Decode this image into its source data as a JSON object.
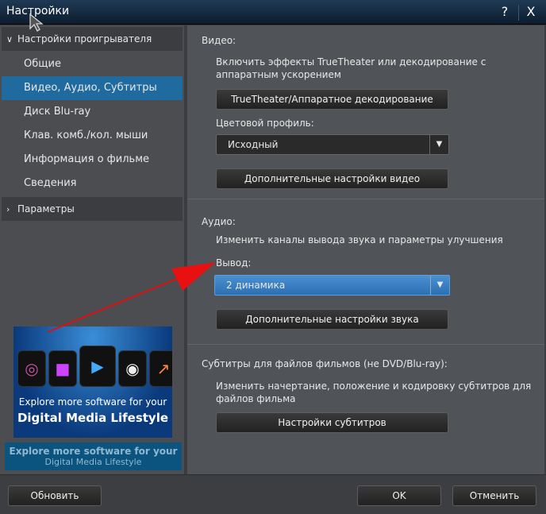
{
  "window": {
    "title": "Настройки",
    "help": "?",
    "close": "X"
  },
  "sidebar": {
    "group1": "Настройки проигрывателя",
    "items": [
      "Общие",
      "Видео, Аудио, Субтитры",
      "Диск Blu-ray",
      "Клав. комб./кол. мыши",
      "Информация о фильме",
      "Сведения"
    ],
    "selected_index": 1,
    "group2": "Параметры",
    "banner": {
      "line1": "Explore more software for your",
      "line2": "Digital Media Lifestyle"
    },
    "banner2": {
      "line1": "Explore more software for your",
      "line2": "Digital Media Lifestyle"
    }
  },
  "video": {
    "heading": "Видео:",
    "desc": "Включить эффекты TrueTheater или декодирование с аппаратным ускорением",
    "truetheater_button": "TrueTheater/Аппаратное декодирование",
    "profile_label": "Цветовой профиль:",
    "profile_value": "Исходный",
    "advanced_button": "Дополнительные настройки видео"
  },
  "audio": {
    "heading": "Аудио:",
    "desc": "Изменить каналы вывода звука и параметры улучшения",
    "output_label": "Вывод:",
    "output_value": "2 динамика",
    "advanced_button": "Дополнительные настройки звука"
  },
  "subtitles": {
    "heading": "Субтитры для файлов фильмов (не DVD/Blu-ray):",
    "desc": "Изменить начертание, положение и кодировку субтитров для файлов фильма",
    "button": "Настройки субтитров"
  },
  "footer": {
    "update": "Обновить",
    "ok": "OK",
    "cancel": "Отменить"
  }
}
